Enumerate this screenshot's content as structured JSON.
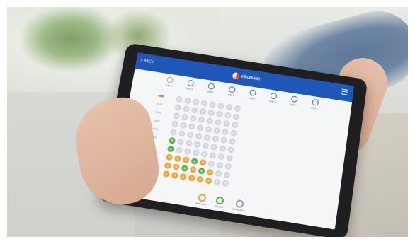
{
  "app": {
    "back_label": "< BACK",
    "logo_text": "VINCIBANK",
    "steps": [
      {
        "label": "STEP 1",
        "state": "done"
      },
      {
        "label": "STEP 2",
        "state": "active"
      },
      {
        "label": "STEP 3",
        "state": "active"
      },
      {
        "label": "STEP 4",
        "state": "active"
      },
      {
        "label": "STEP 5",
        "state": "active"
      },
      {
        "label": "STEP 6",
        "state": "active"
      },
      {
        "label": "STEP 7",
        "state": "active"
      },
      {
        "label": "STEP 8",
        "state": "active"
      }
    ],
    "rows": [
      {
        "label": "08:00",
        "bold": true,
        "cells": [
          "g",
          "g",
          "g",
          "g",
          "g",
          "g",
          "g",
          "g"
        ]
      },
      {
        "label": "07:00",
        "bold": false,
        "cells": [
          "g",
          "g",
          "g",
          "g",
          "g",
          "g",
          "g",
          "g"
        ]
      },
      {
        "label": "06:00",
        "bold": false,
        "cells": [
          "g",
          "g",
          "g",
          "g",
          "g",
          "g",
          "g",
          "g"
        ]
      },
      {
        "label": "05:00",
        "bold": false,
        "cells": [
          "g",
          "g",
          "g",
          "g",
          "g",
          "g",
          "g",
          "g"
        ]
      },
      {
        "label": "04:00",
        "bold": false,
        "cells": [
          "g",
          "g",
          "g",
          "g",
          "g",
          "g",
          "g",
          "g"
        ]
      },
      {
        "label": "03:00",
        "bold": false,
        "cells": [
          "G",
          "g",
          "g",
          "g",
          "g",
          "g",
          "g",
          "g"
        ]
      },
      {
        "label": "02:00",
        "bold": true,
        "cells": [
          "G",
          "g",
          "g",
          "g",
          "g",
          "g",
          "g",
          "g"
        ]
      },
      {
        "label": "01:00",
        "bold": false,
        "cells": [
          "O",
          "O",
          "O",
          "G",
          "O",
          "g",
          "g",
          "g"
        ]
      },
      {
        "label": "00:00",
        "bold": false,
        "cells": [
          "O",
          "O",
          "G",
          "O",
          "G",
          "O",
          "g",
          "g"
        ]
      },
      {
        "label": "23:00",
        "bold": false,
        "cells": [
          "O",
          "O",
          "O",
          "O",
          "O",
          "O",
          "g",
          "g"
        ]
      }
    ],
    "legend": [
      {
        "label": "AVAILABLE",
        "color": "#f0a43a"
      },
      {
        "label": "BOOKED",
        "color": "#5bb349"
      },
      {
        "label": "UNAVAILABLE",
        "color": "#9aa0a8"
      }
    ],
    "help_label": "HELP",
    "colors": {
      "primary": "#1f57b8",
      "green": "#5bb349",
      "orange": "#f0a43a",
      "grey": "#d3d6da"
    }
  }
}
